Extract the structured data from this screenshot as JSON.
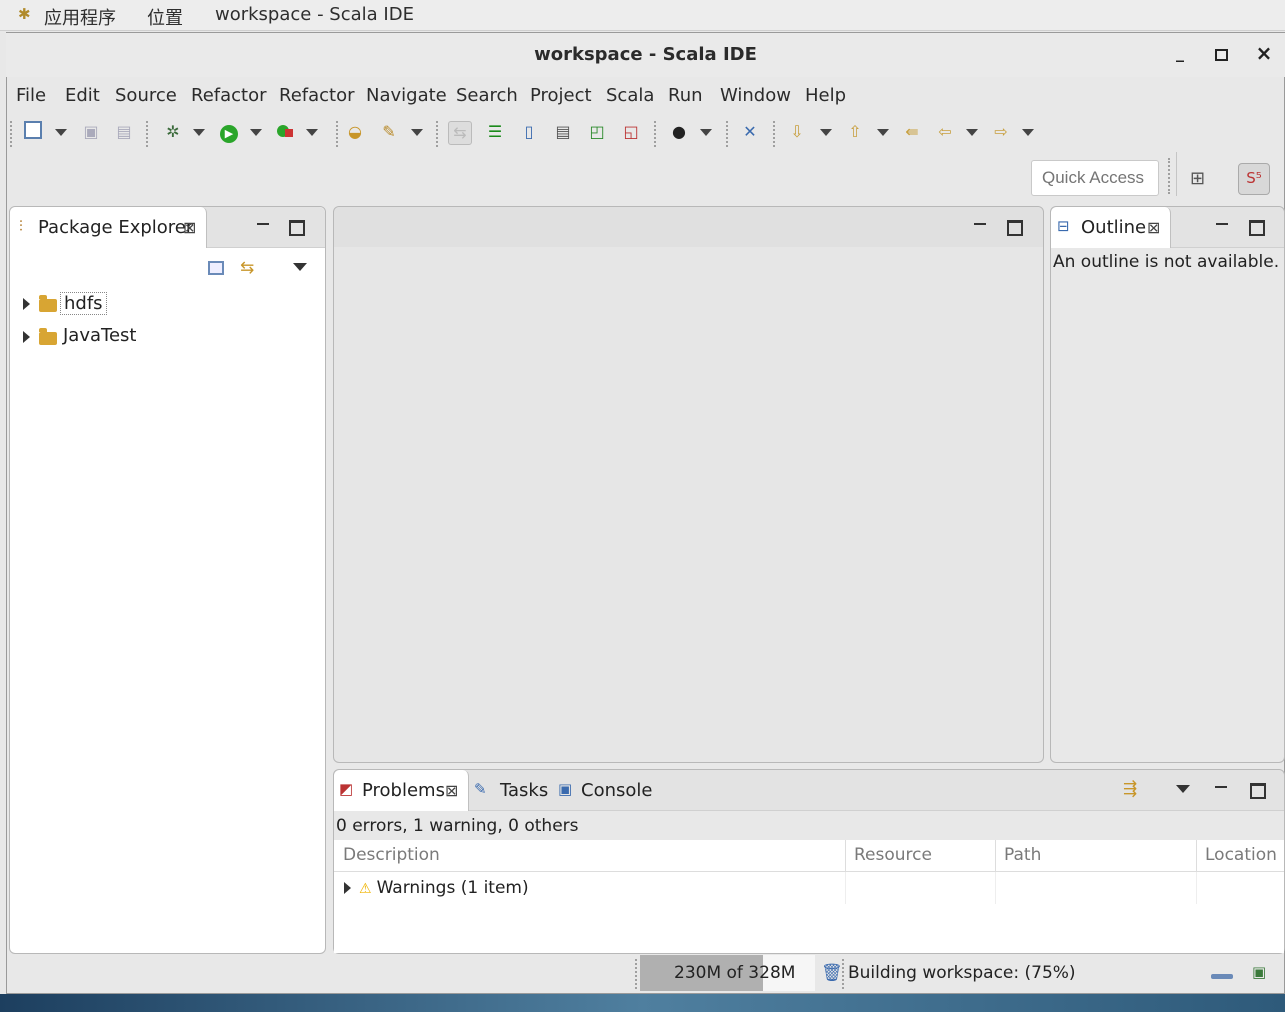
{
  "system_bar": {
    "applications": "应用程序",
    "places": "位置",
    "window_title": "workspace - Scala IDE"
  },
  "window": {
    "title": "workspace - Scala IDE",
    "min_symbol": "_",
    "max_symbol": "□",
    "close_symbol": "×"
  },
  "menu": [
    "File",
    "Edit",
    "Source",
    "Refactor",
    "Refactor",
    "Navigate",
    "Search",
    "Project",
    "Scala",
    "Run",
    "Window",
    "Help"
  ],
  "toolbar": {
    "quick_access_placeholder": "Quick Access"
  },
  "package_explorer": {
    "title": "Package Explorer",
    "close": "⊠",
    "items": [
      {
        "label": "hdfs"
      },
      {
        "label": "JavaTest"
      }
    ]
  },
  "outline": {
    "title": "Outline",
    "close": "⊠",
    "message": "An outline is not available."
  },
  "bottom_panel": {
    "tabs": {
      "problems": "Problems",
      "tasks": "Tasks",
      "console": "Console"
    },
    "close": "⊠",
    "summary": "0 errors, 1 warning, 0 others",
    "columns": [
      "Description",
      "Resource",
      "Path",
      "Location"
    ],
    "rows": [
      {
        "description": "Warnings (1 item)",
        "resource": "",
        "path": "",
        "location": ""
      }
    ]
  },
  "status": {
    "memory": "230M of 328M",
    "memory_fraction": 0.7,
    "build": "Building workspace: (75%)"
  },
  "colors": {
    "folder": "#d8a533",
    "run_green": "#2aa52a",
    "warning": "#f0b400"
  }
}
